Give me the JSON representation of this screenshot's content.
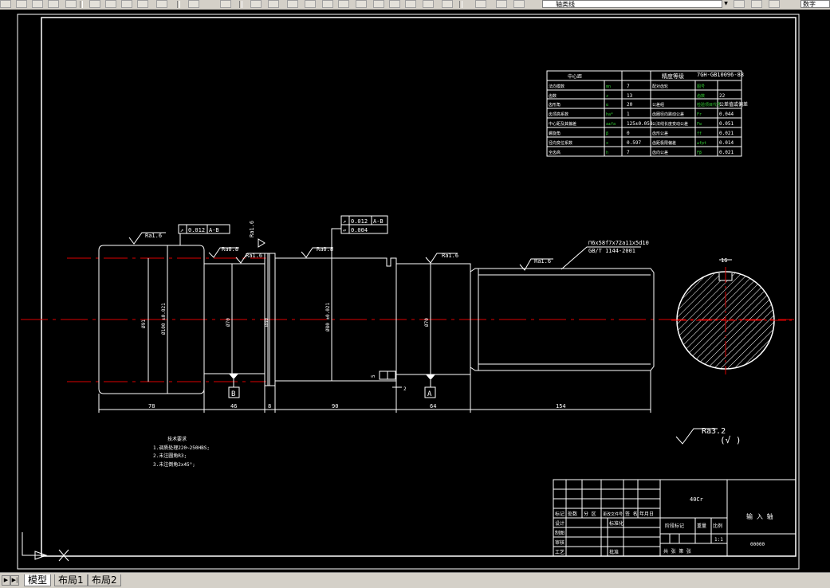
{
  "toolbar": {
    "layer_name": "轴类线",
    "right_field": "数字"
  },
  "layout_tabs": [
    {
      "label": "模型",
      "active": true
    },
    {
      "label": "布局1",
      "active": false
    },
    {
      "label": "布局2",
      "active": false
    }
  ],
  "drawing": {
    "table_code": "7GH-GB10096-88",
    "gear_table": {
      "header_left": "中心距",
      "header_right": "精度等级",
      "rows": [
        {
          "name": "法向模数",
          "sym": "mn",
          "val": "7",
          "name2": "配对齿轮",
          "sym2": "图号",
          "val2": ""
        },
        {
          "name": "齿数",
          "sym": "z",
          "val": "13",
          "name2": "",
          "sym2": "齿数",
          "val2": "22"
        },
        {
          "name": "齿形角",
          "sym": "α",
          "val": "20",
          "name2": "公差组",
          "sym2": "检验项目代号",
          "val2": "公差值或偏差"
        },
        {
          "name": "齿顶高系数",
          "sym": "ha*",
          "val": "1",
          "name2": "齿圈径向跳动公差",
          "sym2": "Fr",
          "val2": "0.044"
        },
        {
          "name": "中心距及其偏差",
          "sym": "a±fa",
          "val": "125±0.058",
          "name2": "公法线长度变动公差",
          "sym2": "Fw",
          "val2": "0.051"
        },
        {
          "name": "螺旋角",
          "sym": "β",
          "val": "0",
          "name2": "齿形公差",
          "sym2": "ff",
          "val2": "0.021"
        },
        {
          "name": "径向变位系数",
          "sym": "x",
          "val": "0.597",
          "name2": "齿距极限偏差",
          "sym2": "±fpt",
          "val2": "0.014"
        },
        {
          "name": "全齿高",
          "sym": "h",
          "val": "7",
          "name2": "齿向公差",
          "sym2": "Fβ",
          "val2": "0.021"
        }
      ]
    },
    "roughness": {
      "ra_1_6": "Ra1.6",
      "ra_0_8": "Ra0.8",
      "ra_3_2": "Ra3.2",
      "ra_1_6_vertical": "Ra1.6"
    },
    "tolerances": {
      "runout_1": "0.012",
      "datum_ab": "A-B",
      "runout_2": "0.012",
      "datum_ab_2": "A-B",
      "flatness": "0.004",
      "runout_symbol": "↗",
      "flatness_symbol": "▱"
    },
    "datums": {
      "b": "B",
      "a": "A"
    },
    "spline_note": "⊓6x58f7x72a11x5d10",
    "spline_std": "GB/T  1144-2001",
    "diameters": {
      "d1": "Ø91",
      "d2": "Ø100 ±0.021",
      "d3": "Ø70",
      "d4": "Ø80",
      "d5": "Ø80 ±0.021",
      "d6": "Ø70"
    },
    "dims": {
      "l1": "78",
      "l2": "46",
      "l3": "8",
      "l4": "90",
      "l5": "64",
      "l6": "154",
      "key_w": "16",
      "groove": "2",
      "groove_h": "5"
    },
    "general_rough": "Ra3.2",
    "tech_req": {
      "title": "技术要求",
      "items": [
        "1.调质处理220~250HBS;",
        "2.未注圆角R3;",
        "3.未注倒角2x45°;"
      ]
    },
    "title_block": {
      "material": "40Cr",
      "part_name": "输 入 轴",
      "drawing_no": "00000",
      "scale": "1:1",
      "row_labels": [
        "设计",
        "制图",
        "审核",
        "工艺"
      ],
      "header_labels": [
        "标记",
        "处数",
        "分 区",
        "更改文件号",
        "签 名",
        "年月日"
      ],
      "std_label": "标准化",
      "approve_label": "批准",
      "stage_label": "阶段标记",
      "weight_label": "重量",
      "scale_label": "比例",
      "sheet_label": "共   张  第   张"
    }
  }
}
